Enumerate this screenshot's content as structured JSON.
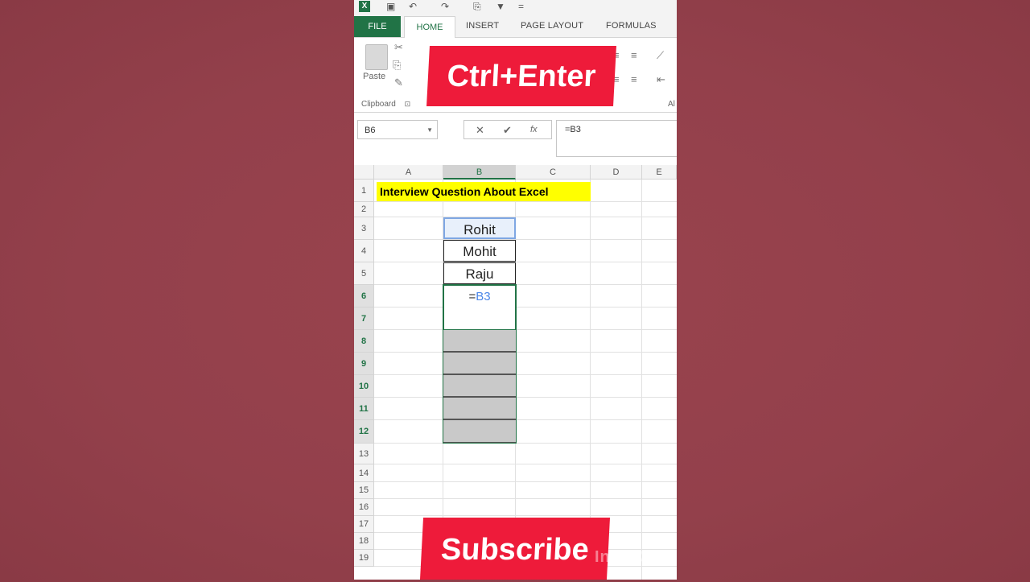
{
  "quick_access": {
    "icons": [
      "excel-logo-icon",
      "save-icon",
      "undo-icon",
      "redo-icon",
      "format-painter-icon",
      "filter-icon"
    ],
    "overflow": "="
  },
  "ribbon_tabs": [
    "FILE",
    "HOME",
    "INSERT",
    "PAGE LAYOUT",
    "FORMULAS"
  ],
  "ribbon": {
    "paste_label": "Paste",
    "clipboard_label": "Clipboard",
    "clipboard_launcher": "⊡",
    "alignment_label_partial": "Al"
  },
  "overlay": {
    "top_banner": "Ctrl+Enter",
    "bottom_banner": "Subscribe",
    "watermark": "InShOt",
    "banner_color": "#ee1b3a"
  },
  "formula_bar": {
    "name_box": "B6",
    "name_box_arrow": "▼",
    "cancel": "✕",
    "enter": "✔",
    "fx": "fx",
    "value": "=B3"
  },
  "columns": [
    "A",
    "B",
    "C",
    "D",
    "E"
  ],
  "rows": [
    "1",
    "2",
    "3",
    "4",
    "5",
    "6",
    "7",
    "8",
    "9",
    "10",
    "11",
    "12",
    "13",
    "14",
    "15",
    "16",
    "17",
    "18",
    "19"
  ],
  "cells": {
    "A1": "Interview Question About Excel",
    "B3": "Rohit",
    "B4": "Mohit",
    "B5": "Raju",
    "B6_prefix": "=",
    "B6_ref": "B3"
  },
  "selection": {
    "active_cell": "B6",
    "range": "B6:B12"
  },
  "colors": {
    "excel_green": "#217346",
    "title_fill": "#ffff00",
    "ref_blue": "#4a86e8",
    "background": "#93404b"
  }
}
